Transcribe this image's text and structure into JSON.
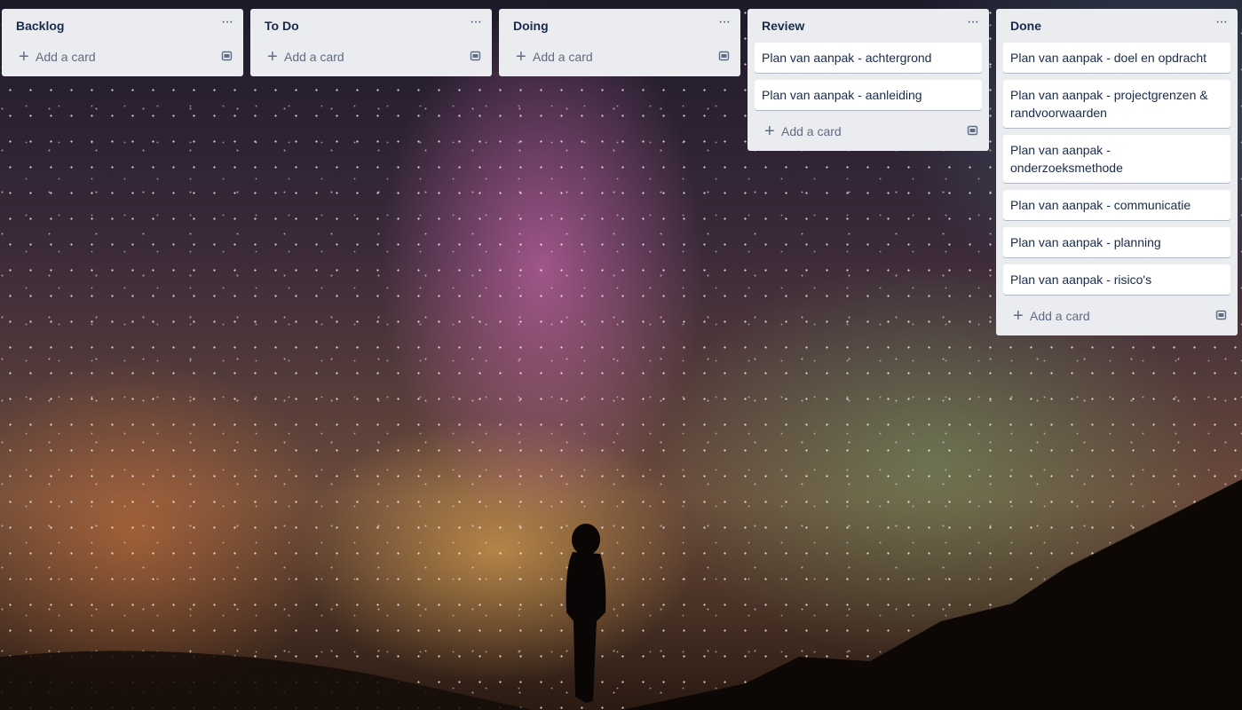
{
  "lists": [
    {
      "title": "Backlog",
      "menu": "···",
      "cards": [],
      "add_label": "Add a card"
    },
    {
      "title": "To Do",
      "menu": "···",
      "cards": [],
      "add_label": "Add a card"
    },
    {
      "title": "Doing",
      "menu": "···",
      "cards": [],
      "add_label": "Add a card"
    },
    {
      "title": "Review",
      "menu": "···",
      "cards": [
        "Plan van aanpak - achtergrond",
        "Plan van aanpak - aanleiding"
      ],
      "add_label": "Add a card"
    },
    {
      "title": "Done",
      "menu": "···",
      "cards": [
        "Plan van aanpak - doel en opdracht",
        "Plan van aanpak - projectgrenzen & randvoorwaarden",
        "Plan van aanpak - onderzoeksmethode",
        "Plan van aanpak - communicatie",
        "Plan van aanpak - planning",
        "Plan van aanpak - risico's"
      ],
      "add_label": "Add a card"
    }
  ],
  "icons": {
    "list_menu": "ellipsis-icon",
    "add": "plus-icon",
    "template": "card-template-icon"
  },
  "colors": {
    "list_background": "#ebecf0",
    "card_background": "#ffffff",
    "title_text": "#172b4d",
    "muted_text": "#5e6c84"
  }
}
